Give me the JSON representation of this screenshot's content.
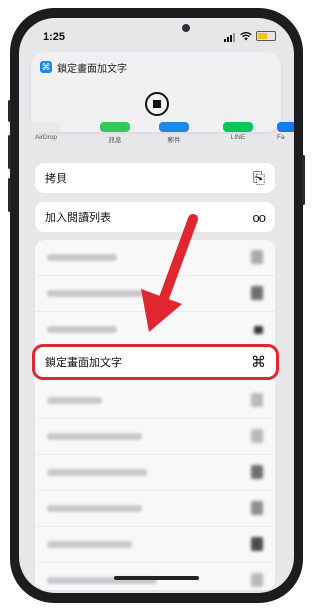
{
  "status_bar": {
    "time": "1:25"
  },
  "banner": {
    "app_icon": "⌘",
    "title": "鎖定畫面加文字"
  },
  "share_sheet": {
    "targets": [
      {
        "label": "AirDrop",
        "color": "#e9e9ec"
      },
      {
        "label": "訊息",
        "color": "#34c759"
      },
      {
        "label": "郵件",
        "color": "#1e88e5"
      },
      {
        "label": "LINE",
        "color": "#06c755"
      },
      {
        "label": "Fa",
        "color": "#1877f2"
      }
    ],
    "actions": [
      {
        "label": "拷貝",
        "icon": "⎘",
        "icon_name": "copy-icon"
      },
      {
        "label": "加入閱讀列表",
        "icon": "oo",
        "icon_name": "glasses-icon"
      }
    ],
    "highlighted_action": {
      "label": "鎖定畫面加文字",
      "icon": "⌘",
      "icon_name": "command-icon",
      "outline_color": "#e0262e"
    }
  },
  "annotation": {
    "arrow_color": "#e0262e"
  }
}
